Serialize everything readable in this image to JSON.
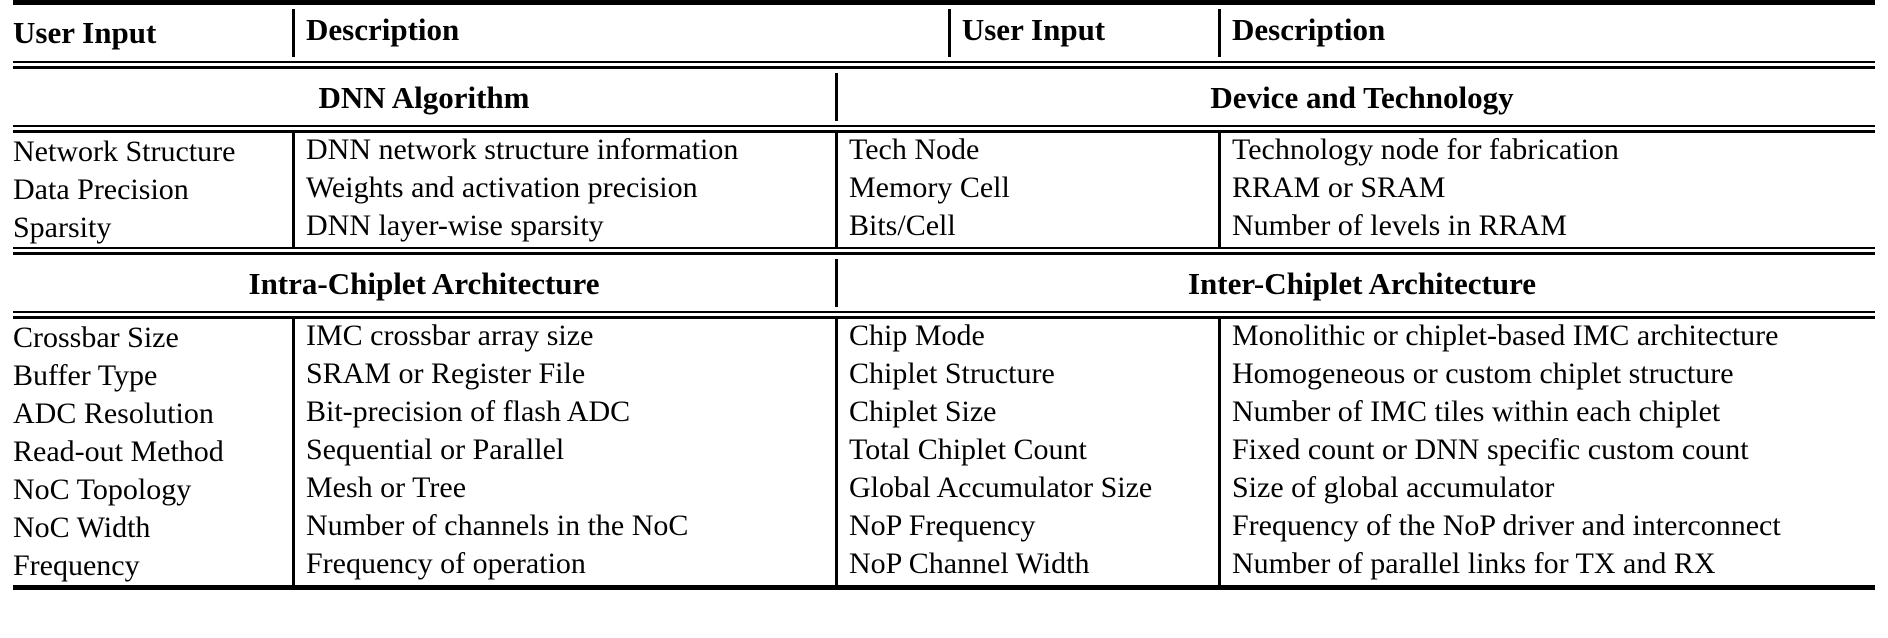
{
  "table": {
    "headers": {
      "user_input": "User Input",
      "description": "Description"
    },
    "sections": [
      {
        "id": "dnn-algorithm",
        "left_title": "DNN Algorithm",
        "right_title": "Device and Technology",
        "left_rows": [
          {
            "input": "Network Structure",
            "description": "DNN network structure information"
          },
          {
            "input": "Data Precision",
            "description": "Weights and activation precision"
          },
          {
            "input": "Sparsity",
            "description": "DNN layer-wise sparsity"
          }
        ],
        "right_rows": [
          {
            "input": "Tech Node",
            "description": "Technology node for fabrication"
          },
          {
            "input": "Memory Cell",
            "description": "RRAM or SRAM"
          },
          {
            "input": "Bits/Cell",
            "description": "Number of levels in RRAM"
          }
        ]
      },
      {
        "id": "chiplet-architecture",
        "left_title": "Intra-Chiplet Architecture",
        "right_title": "Inter-Chiplet Architecture",
        "left_rows": [
          {
            "input": "Crossbar Size",
            "description": "IMC crossbar array size"
          },
          {
            "input": "Buffer Type",
            "description": "SRAM or Register File"
          },
          {
            "input": "ADC Resolution",
            "description": "Bit-precision of flash ADC"
          },
          {
            "input": "Read-out Method",
            "description": "Sequential or Parallel"
          },
          {
            "input": "NoC Topology",
            "description": "Mesh or Tree"
          },
          {
            "input": "NoC Width",
            "description": "Number of channels in the NoC"
          },
          {
            "input": "Frequency",
            "description": "Frequency of operation"
          }
        ],
        "right_rows": [
          {
            "input": "Chip Mode",
            "description": "Monolithic or chiplet-based IMC architecture"
          },
          {
            "input": "Chiplet Structure",
            "description": "Homogeneous or custom chiplet structure"
          },
          {
            "input": "Chiplet Size",
            "description": "Number of IMC tiles within each chiplet"
          },
          {
            "input": "Total Chiplet Count",
            "description": "Fixed count or DNN specific custom count"
          },
          {
            "input": "Global Accumulator Size",
            "description": "Size of global accumulator"
          },
          {
            "input": "NoP Frequency",
            "description": "Frequency of the NoP driver and interconnect"
          },
          {
            "input": "NoP Channel Width",
            "description": "Number of parallel links for TX and RX"
          }
        ]
      }
    ]
  }
}
